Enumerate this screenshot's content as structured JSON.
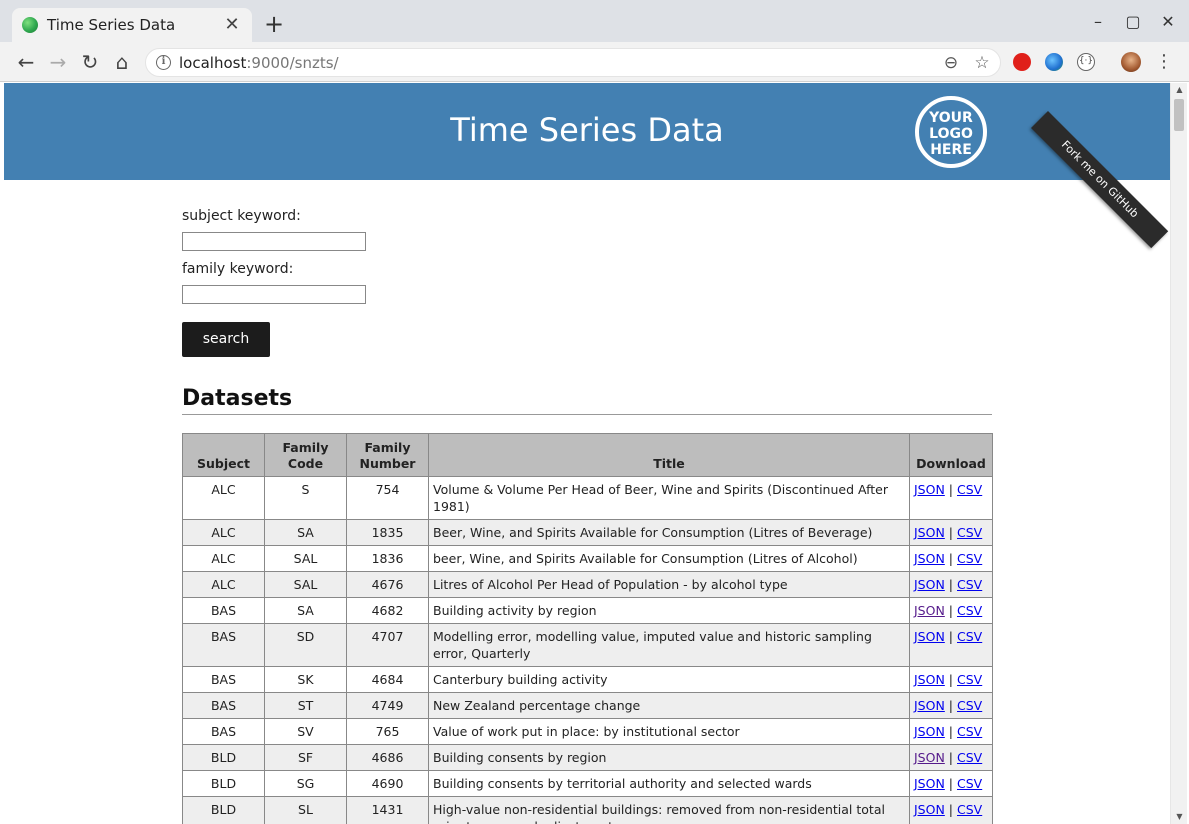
{
  "browser": {
    "tab_title": "Time Series Data",
    "new_tab": "+",
    "tab_close": "✕",
    "url_host": "localhost",
    "url_rest": ":9000/snzts/",
    "win_min": "–",
    "win_max": "▢",
    "win_close": "✕"
  },
  "header": {
    "title": "Time Series Data",
    "logo_text": "YOUR LOGO HERE",
    "ribbon": "Fork me on GitHub"
  },
  "form": {
    "subject_label": "subject keyword:",
    "subject_value": "",
    "family_label": "family keyword:",
    "family_value": "",
    "search_label": "search"
  },
  "datasets": {
    "heading": "Datasets",
    "columns": [
      "Subject",
      "Family Code",
      "Family Number",
      "Title",
      "Download"
    ],
    "json_label": "JSON",
    "csv_label": "CSV",
    "separator": "|",
    "rows": [
      {
        "subject": "ALC",
        "code": "S",
        "number": "754",
        "title": "Volume & Volume Per Head of Beer, Wine and Spirits (Discontinued After 1981)",
        "json_visited": false
      },
      {
        "subject": "ALC",
        "code": "SA",
        "number": "1835",
        "title": "Beer, Wine, and Spirits Available for Consumption (Litres of Beverage)",
        "json_visited": false
      },
      {
        "subject": "ALC",
        "code": "SAL",
        "number": "1836",
        "title": "beer, Wine, and Spirits Available for Consumption (Litres of Alcohol)",
        "json_visited": false
      },
      {
        "subject": "ALC",
        "code": "SAL",
        "number": "4676",
        "title": "Litres of Alcohol Per Head of Population - by alcohol type",
        "json_visited": false
      },
      {
        "subject": "BAS",
        "code": "SA",
        "number": "4682",
        "title": "Building activity by region",
        "json_visited": true
      },
      {
        "subject": "BAS",
        "code": "SD",
        "number": "4707",
        "title": "Modelling error, modelling value, imputed value and historic sampling error, Quarterly",
        "json_visited": false
      },
      {
        "subject": "BAS",
        "code": "SK",
        "number": "4684",
        "title": "Canterbury building activity",
        "json_visited": false
      },
      {
        "subject": "BAS",
        "code": "ST",
        "number": "4749",
        "title": "New Zealand percentage change",
        "json_visited": false
      },
      {
        "subject": "BAS",
        "code": "SV",
        "number": "765",
        "title": "Value of work put in place: by institutional sector",
        "json_visited": false
      },
      {
        "subject": "BLD",
        "code": "SF",
        "number": "4686",
        "title": "Building consents by region",
        "json_visited": true
      },
      {
        "subject": "BLD",
        "code": "SG",
        "number": "4690",
        "title": "Building consents by territorial authority and selected wards",
        "json_visited": false
      },
      {
        "subject": "BLD",
        "code": "SL",
        "number": "1431",
        "title": "High-value non-residential buildings: removed from non-residential total prior to seasonal adjustment",
        "json_visited": false
      }
    ]
  }
}
